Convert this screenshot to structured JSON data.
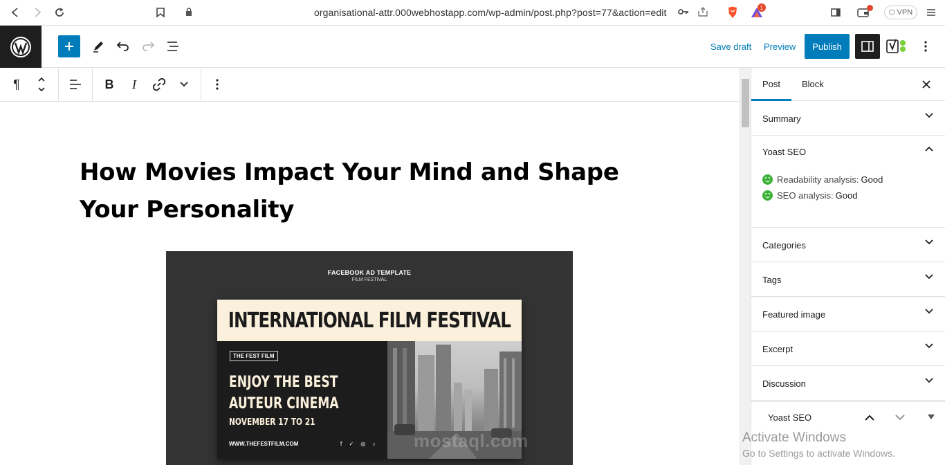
{
  "browser": {
    "url": "organisational-attr.000webhostapp.com/wp-admin/post.php?post=77&action=edit",
    "vpn_label": "VPN",
    "badge_count": "1"
  },
  "header": {
    "save_draft": "Save draft",
    "preview": "Preview",
    "publish": "Publish"
  },
  "post": {
    "title": "How Movies Impact Your Mind and Shape Your Personality",
    "image": {
      "top_label": "FACEBOOK AD TEMPLATE",
      "top_sub": "FILM FESTIVAL",
      "banner": "INTERNATIONAL FILM FESTIVAL",
      "tag": "THE FEST FILM",
      "headline_line1": "ENJOY THE BEST",
      "headline_line2": "AUTEUR CINEMA",
      "dates": "NOVEMBER 17 TO 21",
      "website": "WWW.THEFESTFILM.COM",
      "socials": "f ✓ ◎ ♪",
      "watermark": "mostaql.com"
    }
  },
  "sidebar": {
    "tab_post": "Post",
    "tab_block": "Block",
    "panels": {
      "summary": "Summary",
      "yoast": "Yoast SEO",
      "categories": "Categories",
      "tags": "Tags",
      "featured_image": "Featured image",
      "excerpt": "Excerpt",
      "discussion": "Discussion"
    },
    "readability_label": "Readability analysis:",
    "readability_value": "Good",
    "seo_label": "SEO analysis:",
    "seo_value": "Good",
    "yoast_footer": "Yoast SEO"
  },
  "os": {
    "activate_title": "Activate Windows",
    "activate_sub": "Go to Settings to activate Windows."
  },
  "colors": {
    "accent": "#007cba",
    "good": "#3cb23b",
    "dark": "#1e1e1e"
  }
}
